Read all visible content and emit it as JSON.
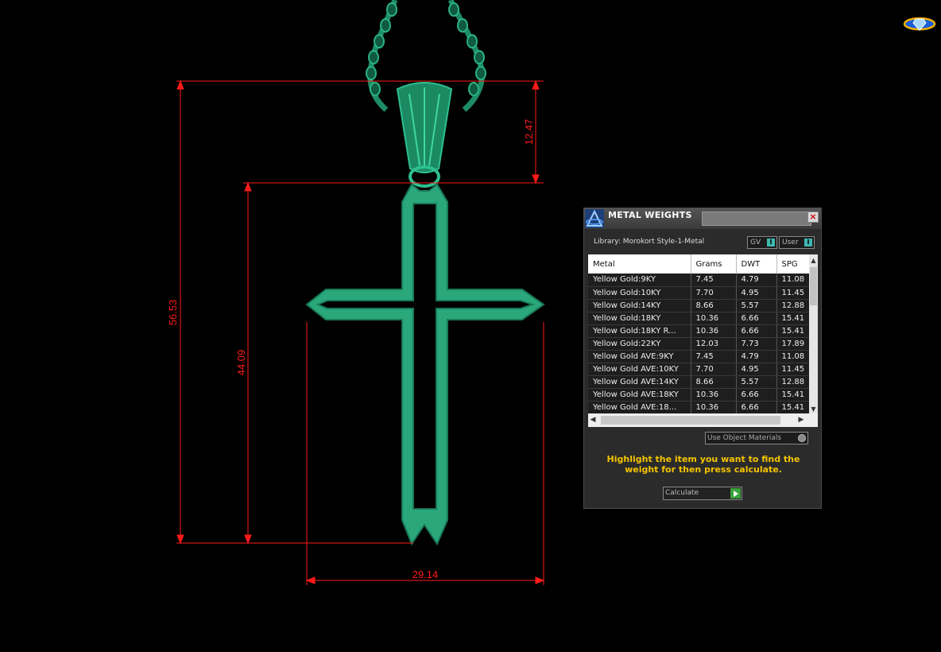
{
  "dimensions": {
    "total_height": "56.53",
    "cross_height": "44.09",
    "bail_height": "12.47",
    "cross_width": "29.14"
  },
  "panel": {
    "title": "METAL WEIGHTS",
    "close_label": "×",
    "library": "Library: Morokort Style-1-Metal",
    "toggle_gv": "GV",
    "toggle_user": "User",
    "columns": [
      "Metal",
      "Grams",
      "DWT",
      "SPG"
    ],
    "rows": [
      [
        "Yellow Gold:9KY",
        "7.45",
        "4.79",
        "11.08"
      ],
      [
        "Yellow Gold:10KY",
        "7.70",
        "4.95",
        "11.45"
      ],
      [
        "Yellow Gold:14KY",
        "8.66",
        "5.57",
        "12.88"
      ],
      [
        "Yellow Gold:18KY",
        "10.36",
        "6.66",
        "15.41"
      ],
      [
        "Yellow Gold:18KY R...",
        "10.36",
        "6.66",
        "15.41"
      ],
      [
        "Yellow Gold:22KY",
        "12.03",
        "7.73",
        "17.89"
      ],
      [
        "Yellow Gold AVE:9KY",
        "7.45",
        "4.79",
        "11.08"
      ],
      [
        "Yellow Gold AVE:10KY",
        "7.70",
        "4.95",
        "11.45"
      ],
      [
        "Yellow Gold AVE:14KY",
        "8.66",
        "5.57",
        "12.88"
      ],
      [
        "Yellow Gold AVE:18KY",
        "10.36",
        "6.66",
        "15.41"
      ],
      [
        "Yellow Gold AVE:18...",
        "10.36",
        "6.66",
        "15.41"
      ]
    ],
    "use_object_materials": "Use Object Materials",
    "hint": "Highlight the item you want to find the weight for then press calculate.",
    "calculate_label": "Calculate"
  },
  "colors": {
    "metal": "#2aa87c",
    "dimension": "#ff1a1a",
    "hint": "#f5c400"
  }
}
